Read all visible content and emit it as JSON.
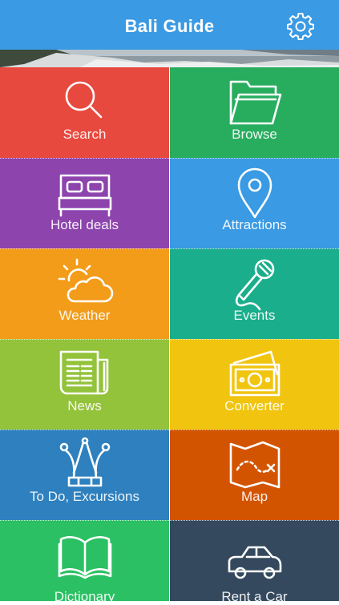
{
  "header": {
    "title": "Bali Guide",
    "settings_icon": "gear-icon",
    "background": "#3a9ae3"
  },
  "tiles": [
    {
      "label": "Search",
      "icon": "search-icon",
      "color": "#e8493f"
    },
    {
      "label": "Browse",
      "icon": "folder-icon",
      "color": "#28ad5f"
    },
    {
      "label": "Hotel deals",
      "icon": "bed-icon",
      "color": "#8d44ad"
    },
    {
      "label": "Attractions",
      "icon": "map-pin-icon",
      "color": "#3a9ae3"
    },
    {
      "label": "Weather",
      "icon": "weather-icon",
      "color": "#f39c1a"
    },
    {
      "label": "Events",
      "icon": "microphone-icon",
      "color": "#1aae8c"
    },
    {
      "label": "News",
      "icon": "newspaper-icon",
      "color": "#93c23b"
    },
    {
      "label": "Converter",
      "icon": "money-icon",
      "color": "#f1c40f"
    },
    {
      "label": "To Do, Excursions",
      "icon": "jester-hat-icon",
      "color": "#2e80be"
    },
    {
      "label": "Map",
      "icon": "treasure-map-icon",
      "color": "#d35400"
    },
    {
      "label": "Dictionary",
      "icon": "book-icon",
      "color": "#2bc063"
    },
    {
      "label": "Rent a Car",
      "icon": "car-icon",
      "color": "#34495e"
    }
  ]
}
